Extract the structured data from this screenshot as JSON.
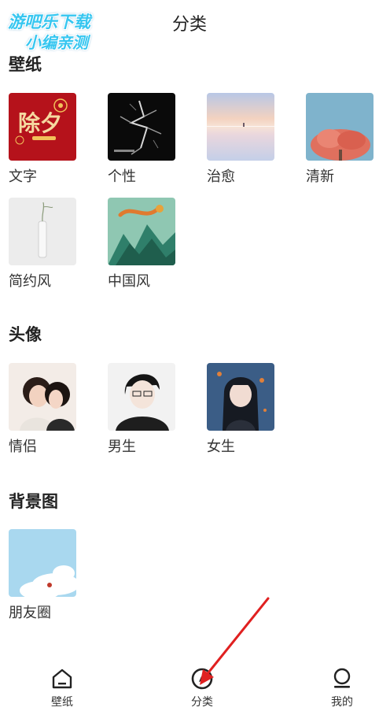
{
  "header": {
    "title": "分类"
  },
  "watermark": {
    "line1": "游吧乐下载",
    "line2": "小编亲测"
  },
  "sections": {
    "wallpaper": {
      "title": "壁纸",
      "items": [
        {
          "label": "文字",
          "thumb_text": "除夕"
        },
        {
          "label": "个性"
        },
        {
          "label": "治愈"
        },
        {
          "label": "清新"
        },
        {
          "label": "简约风"
        },
        {
          "label": "中国风"
        }
      ]
    },
    "avatar": {
      "title": "头像",
      "items": [
        {
          "label": "情侣"
        },
        {
          "label": "男生"
        },
        {
          "label": "女生"
        }
      ]
    },
    "background": {
      "title": "背景图",
      "items": [
        {
          "label": "朋友圈"
        }
      ]
    }
  },
  "nav": {
    "items": [
      {
        "label": "壁纸",
        "icon": "home-icon"
      },
      {
        "label": "分类",
        "icon": "category-icon",
        "active": true
      },
      {
        "label": "我的",
        "icon": "profile-icon"
      }
    ]
  },
  "annotation": {
    "color": "#e02020"
  },
  "colors": {
    "watermark": "#36c6f0",
    "text": "#222222"
  }
}
